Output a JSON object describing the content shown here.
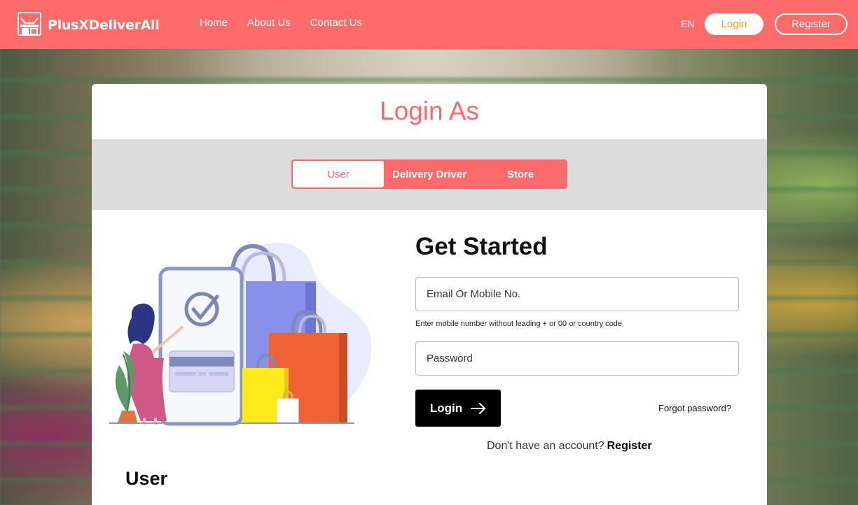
{
  "header": {
    "brand": "PlusXDeliverAll",
    "nav": [
      {
        "label": "Home"
      },
      {
        "label": "About Us"
      },
      {
        "label": "Contact Us"
      }
    ],
    "language": "EN",
    "login_label": "Login",
    "register_label": "Register"
  },
  "card": {
    "title": "Login As",
    "roles": [
      {
        "label": "User",
        "active": true
      },
      {
        "label": "Delivery Driver",
        "active": false
      },
      {
        "label": "Store",
        "active": false
      }
    ],
    "form": {
      "heading": "Get Started",
      "email_placeholder": "Email Or Mobile No.",
      "email_value": "",
      "hint": "Enter mobile number without leading + or 00 or country code",
      "password_placeholder": "Password",
      "password_value": "",
      "login_label": "Login",
      "forgot_label": "Forgot password?",
      "no_account_text": "Don't have an account?",
      "register_link": "Register"
    },
    "section_heading": "User"
  },
  "colors": {
    "brand": "#fe6b6b",
    "accent_text": "#f5a11b",
    "primary_button": "#000000"
  },
  "icons": {
    "logo": "shop-logo-icon",
    "login_arrow": "arrow-right-icon"
  }
}
